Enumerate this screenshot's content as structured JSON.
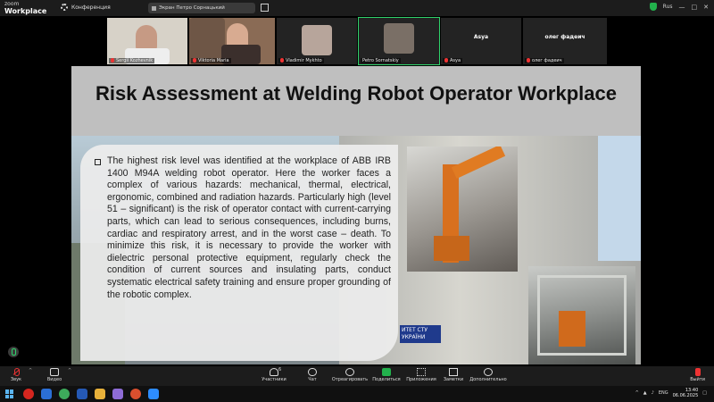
{
  "app": {
    "logo_line1": "zoom",
    "logo_line2": "Workplace",
    "conference_label": "Конференция",
    "speaker_label": "Экран Петро Сорнацький",
    "language": "Rus"
  },
  "gallery": [
    {
      "name": "Sergii Kozhevnik",
      "muted": true,
      "video": true
    },
    {
      "name": "Viktoria Maria",
      "muted": true,
      "video": true
    },
    {
      "name": "Vladimir Mykhto",
      "muted": true,
      "video": true
    },
    {
      "name": "Petro Sornatskiy",
      "muted": false,
      "video": true,
      "active": true
    },
    {
      "name": "Asya",
      "center_label": "Asya",
      "muted": true,
      "video": false
    },
    {
      "name": "олег фадеич",
      "center_label": "олег фадеич",
      "muted": true,
      "video": false
    }
  ],
  "slide": {
    "title": "Risk Assessment at Welding Robot Operator Workplace",
    "body": "The highest risk level was identified at the workplace of ABB IRB 1400 M94A welding robot operator. Here the worker faces a complex of various hazards: mechanical, thermal, electrical, ergonomic, combined and radiation hazards. Particularly high (level 51 – significant) is the risk of operator contact with current-carrying parts, which can lead to serious consequences, including burns, cardiac and respiratory arrest, and in the worst case – death. To minimize this risk, it is necessary to provide the worker with dielectric personal protective equipment, regularly check the condition of current sources and insulating parts, conduct systematic electrical safety training and ensure proper grounding of the robotic complex.",
    "sign_text": "ИТЕТ СТУ УКРАЇНИ"
  },
  "toolbar": {
    "mic": "Звук",
    "video": "Видео",
    "participants": "Участники",
    "participants_count": "6",
    "chat": "Чат",
    "react": "Отреагировать",
    "share": "Поделиться",
    "apps": "Приложения",
    "notes": "Заметки",
    "more": "Дополнительно",
    "leave": "Выйти"
  },
  "taskbar": {
    "time": "13:40",
    "date": "06.06.2025",
    "lang": "ENG"
  },
  "colors": {
    "accent_green": "#2fd26b",
    "share_green": "#22b14c",
    "mute_red": "#e33333",
    "slide_header": "#bfbfbf"
  }
}
